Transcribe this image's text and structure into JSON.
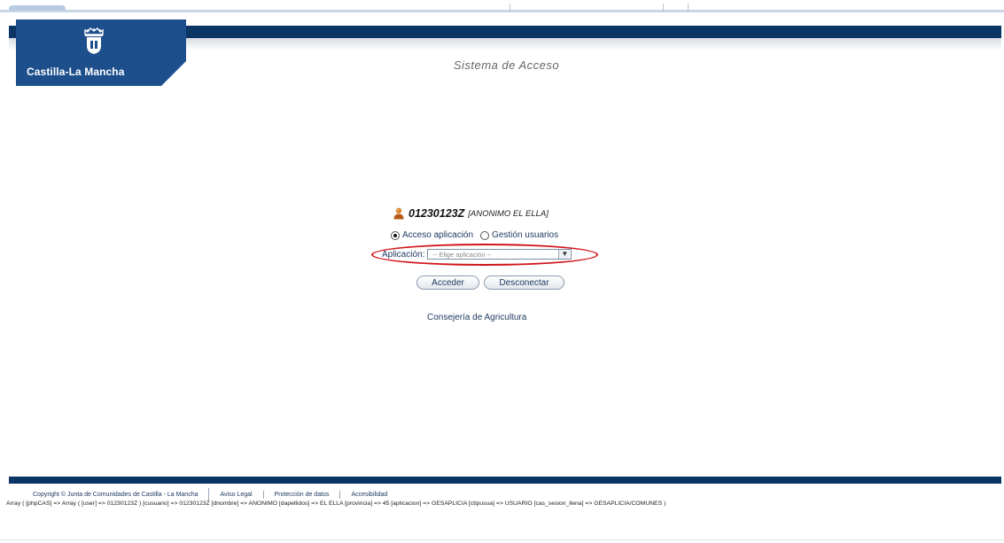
{
  "header": {
    "brand_name": "Castilla-La Mancha",
    "system_title": "Sistema de Acceso"
  },
  "user": {
    "id": "01230123Z",
    "name": "[ANONIMO EL ELLA]"
  },
  "access_mode": {
    "options": [
      "Acceso aplicación",
      "Gestión usuarios"
    ],
    "selected": "Acceso aplicación"
  },
  "application_select": {
    "label": "Aplicación:",
    "value": "-- Elige aplicación --"
  },
  "buttons": {
    "submit": "Acceder",
    "logout": "Desconectar"
  },
  "organization": "Consejería de Agricultura",
  "footer": {
    "copyright": "Copyright © Junta de Comunidades de Castilla - La Mancha",
    "legal": "Aviso Legal",
    "privacy": "Protección de datos",
    "accessibility": "Accesibilidad",
    "debug": "Array ( [phpCAS] => Array ( [user] => 01230123Z ) [cusuario] => 01230123Z [dnombre] => ANONIMO [dapellidos] => EL ELLA [provincia] => 45 [aplicacion] => GESAPLICIA [ctipusua] => USUARIO [cas_sesion_llena] => GESAPLICIA/COMUNES )"
  },
  "colors": {
    "header_navy": "#0b3564",
    "logo_blue": "#1d4f8c",
    "highlight_red": "#d0141a",
    "link_blue": "#1f3b63"
  }
}
